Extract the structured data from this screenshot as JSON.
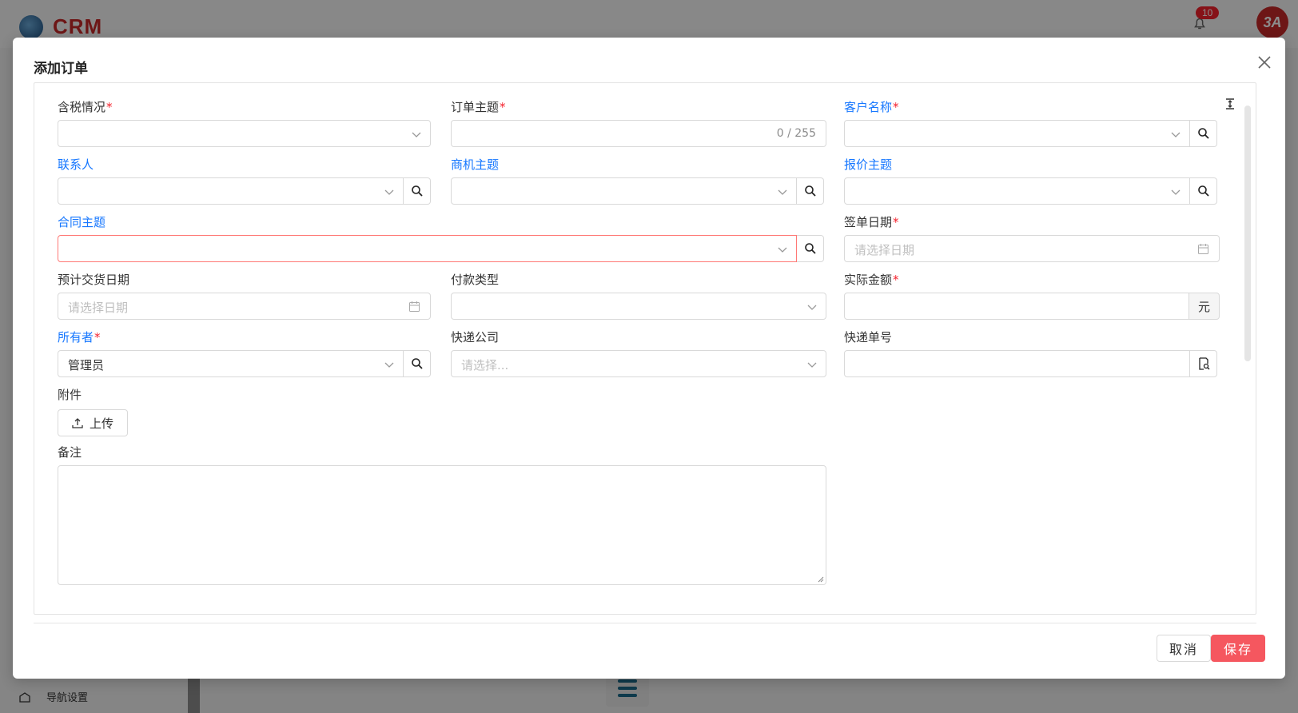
{
  "app": {
    "logo_text": "CRM",
    "notification_count": "10",
    "avatar_text": "3A",
    "nav_settings_label": "导航设置"
  },
  "modal": {
    "title": "添加订单",
    "fields": {
      "tax": {
        "label": "含税情况",
        "required": "*"
      },
      "order_subject": {
        "label": "订单主题",
        "required": "*",
        "counter": "0 / 255"
      },
      "customer_name": {
        "label": "客户名称",
        "required": "*"
      },
      "contact": {
        "label": "联系人"
      },
      "opportunity": {
        "label": "商机主题"
      },
      "quote": {
        "label": "报价主题"
      },
      "contract": {
        "label": "合同主题"
      },
      "sign_date": {
        "label": "签单日期",
        "required": "*",
        "placeholder": "请选择日期"
      },
      "delivery_date": {
        "label": "预计交货日期",
        "placeholder": "请选择日期"
      },
      "payment_type": {
        "label": "付款类型"
      },
      "actual_amount": {
        "label": "实际金额",
        "required": "*",
        "unit": "元"
      },
      "owner": {
        "label": "所有者",
        "required": "*",
        "value": "管理员"
      },
      "courier_company": {
        "label": "快递公司",
        "placeholder": "请选择..."
      },
      "tracking_number": {
        "label": "快递单号"
      },
      "attachment": {
        "label": "附件",
        "upload_label": "上传"
      },
      "remarks": {
        "label": "备注"
      }
    },
    "buttons": {
      "cancel": "取消",
      "save": "保存"
    }
  },
  "colors": {
    "link": "#1677ff",
    "required": "#f5222d",
    "save": "#f5575f",
    "error_border": "#ff7875"
  }
}
